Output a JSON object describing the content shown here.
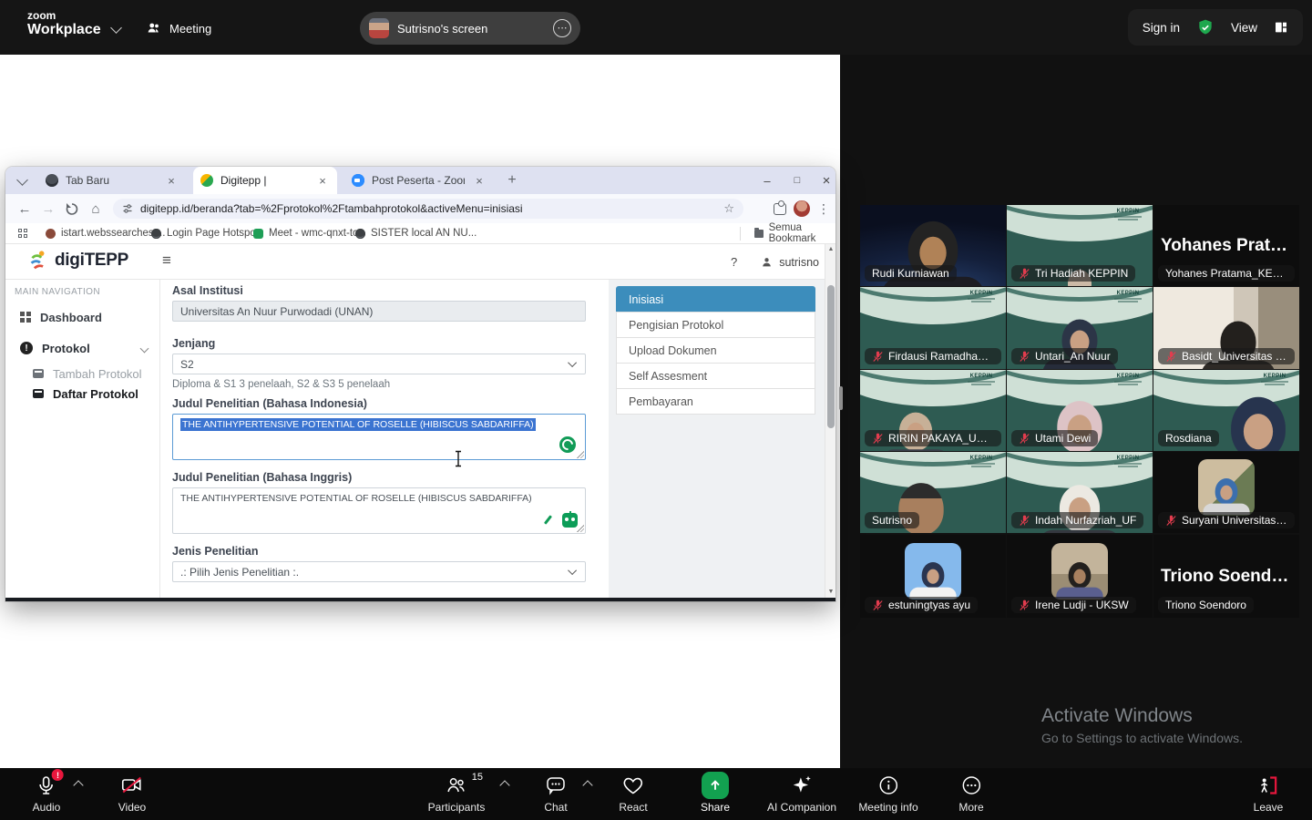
{
  "zoom_top_bar": {
    "logo_small": "zoom",
    "logo_main": "Workplace",
    "meeting_tab": "Meeting",
    "shared_screen_label": "Sutrisno's screen",
    "sign_in": "Sign in",
    "view": "View"
  },
  "browser": {
    "tabs": [
      {
        "title": "Tab Baru"
      },
      {
        "title": "Digitepp |"
      },
      {
        "title": "Post Peserta - Zoom"
      }
    ],
    "url": "digitepp.id/beranda?tab=%2Fprotokol%2Ftambahprotokol&activeMenu=inisiasi",
    "bookmarks": [
      "istart.webssearches....",
      "Login Page Hotspot",
      "Meet - wmc-qnxt-tcc",
      "SISTER local AN NU..."
    ],
    "bookmarks_right": "Semua Bookmark"
  },
  "app": {
    "brand": "digiTEPP",
    "help": "?",
    "user": "sutrisno",
    "nav_heading": "MAIN NAVIGATION",
    "nav": [
      "Dashboard",
      "Protokol",
      "Tambah Protokol",
      "Daftar Protokol"
    ],
    "form": {
      "asal_label": "Asal Institusi",
      "asal_value": "Universitas An Nuur Purwodadi (UNAN)",
      "jenjang_label": "Jenjang",
      "jenjang_value": "S2",
      "jenjang_help": "Diploma & S1 3 penelaah, S2 & S3 5 penelaah",
      "judul_id_label": "Judul Penelitian (Bahasa Indonesia)",
      "judul_id_value": "THE ANTIHYPERTENSIVE POTENTIAL OF ROSELLE (HIBISCUS SABDARIFFA)",
      "judul_en_label": "Judul Penelitian (Bahasa Inggris)",
      "judul_en_value": "THE ANTIHYPERTENSIVE POTENTIAL OF ROSELLE (HIBISCUS SABDARIFFA)",
      "jenis_label": "Jenis Penelitian",
      "jenis_placeholder": ".: Pilih Jenis Penelitian :."
    },
    "stepper": [
      "Inisiasi",
      "Pengisian Protokol",
      "Upload Dokumen",
      "Self Assesment",
      "Pembayaran"
    ]
  },
  "video_grid": {
    "keppin_logo": "KEPPIN"
  },
  "participants": [
    {
      "name": "Rudi Kurniawan",
      "muted": false
    },
    {
      "name": "Tri Hadiah KEPPIN",
      "muted": true
    },
    {
      "name": "Yohanes Pratama_KEPPIN",
      "center": "Yohanes  Pratam...",
      "muted": false
    },
    {
      "name": "Firdausi Ramadhani_...",
      "muted": true
    },
    {
      "name": "Untari_An Nuur",
      "muted": true
    },
    {
      "name": "Basidt_Universitas an ...",
      "muted": true
    },
    {
      "name": "RIRIN PAKAYA_UNIGO",
      "muted": true
    },
    {
      "name": "Utami Dewi",
      "muted": true
    },
    {
      "name": "Rosdiana",
      "muted": false
    },
    {
      "name": "Sutrisno",
      "muted": false,
      "active_speaker": true
    },
    {
      "name": "Indah Nurfazriah_UF",
      "muted": true
    },
    {
      "name": "Suryani Universitas A...",
      "muted": true
    },
    {
      "name": "estuningtyas ayu",
      "muted": true
    },
    {
      "name": "Irene Ludji - UKSW",
      "muted": true
    },
    {
      "name": "Triono Soendoro",
      "center": "Triono Soendoro",
      "muted": false
    }
  ],
  "watermark": {
    "title": "Activate Windows",
    "subtitle": "Go to Settings to activate Windows."
  },
  "toolbar": {
    "audio": "Audio",
    "video": "Video",
    "participants": "Participants",
    "participants_count": "15",
    "chat": "Chat",
    "react": "React",
    "share": "Share",
    "ai_companion": "AI Companion",
    "meeting_info": "Meeting info",
    "more": "More",
    "leave": "Leave"
  },
  "icons": {
    "close": "×",
    "minimize": "–",
    "maximize": "□",
    "plus": "+",
    "back": "←",
    "forward": "→",
    "home": "⌂",
    "star": "☆",
    "menu_v": "⋮",
    "menu_h": "⋯",
    "hamburger": "≡",
    "scroll_up": "▲",
    "scroll_down": "▼",
    "info_i": "i",
    "exclaim": "!"
  },
  "colors": {
    "stepper_active_blue": "#3c8dbc",
    "share_green": "#12a150",
    "mute_red": "#e23c4e",
    "active_speaker_green": "#2bd46b",
    "selection_blue": "#3b74d1"
  }
}
